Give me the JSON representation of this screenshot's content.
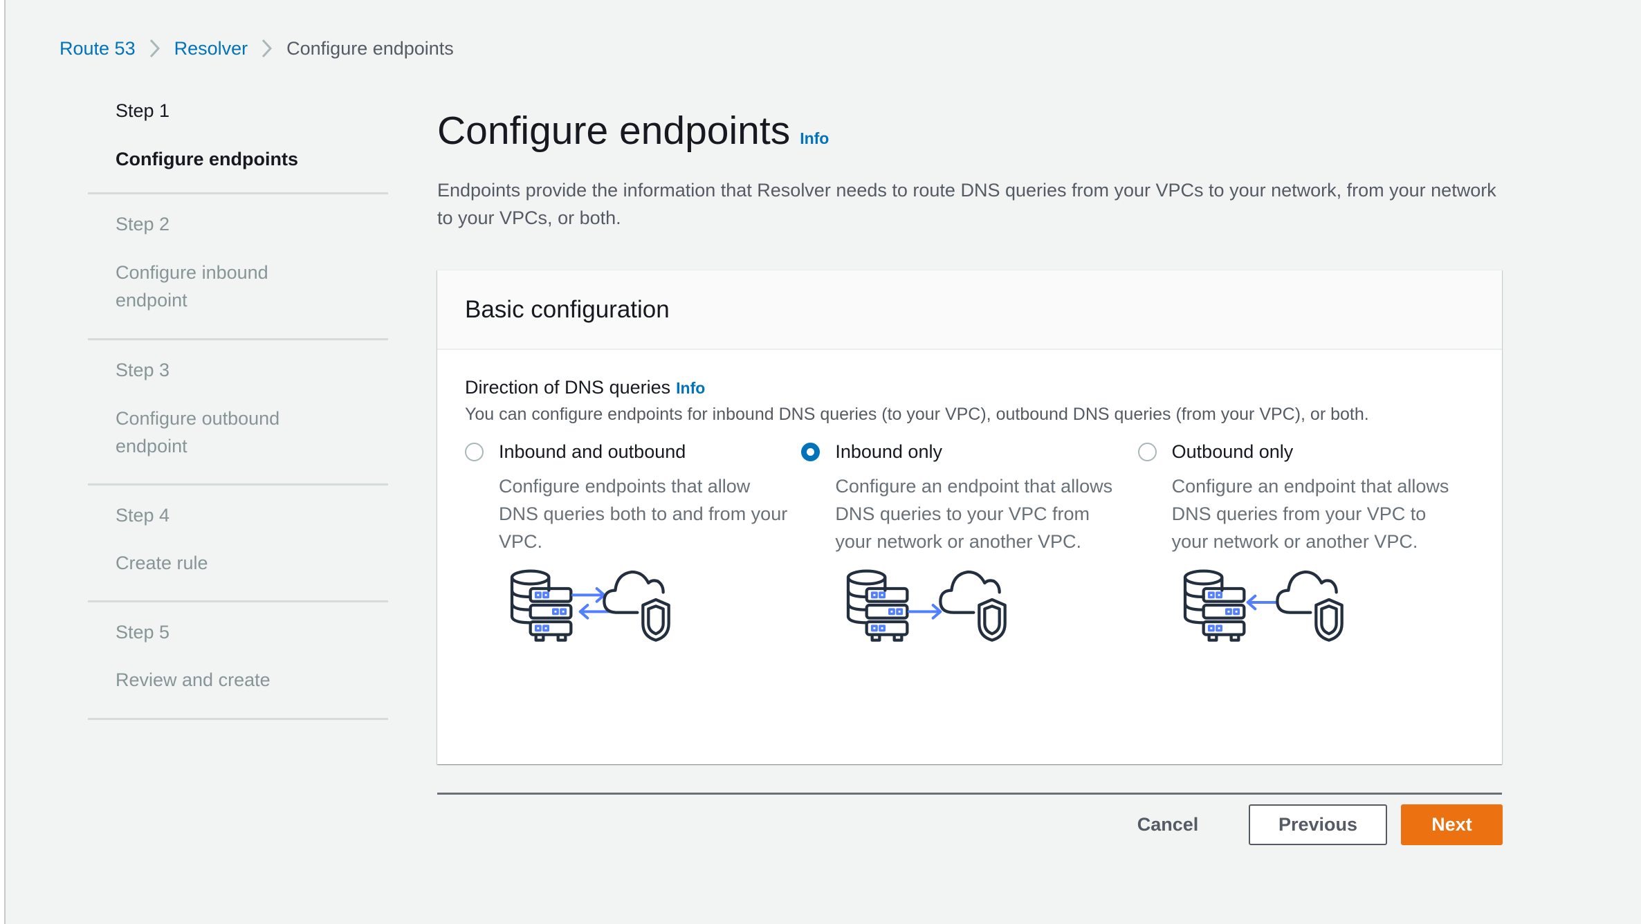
{
  "breadcrumb": {
    "items": [
      {
        "label": "Route 53",
        "link": true
      },
      {
        "label": "Resolver",
        "link": true
      },
      {
        "label": "Configure endpoints",
        "link": false
      }
    ]
  },
  "sidebar": {
    "steps": [
      {
        "number": "Step 1",
        "title": "Configure endpoints",
        "active": true
      },
      {
        "number": "Step 2",
        "title": "Configure inbound endpoint",
        "active": false
      },
      {
        "number": "Step 3",
        "title": "Configure outbound endpoint",
        "active": false
      },
      {
        "number": "Step 4",
        "title": "Create rule",
        "active": false
      },
      {
        "number": "Step 5",
        "title": "Review and create",
        "active": false
      }
    ]
  },
  "main": {
    "title": "Configure endpoints",
    "info_label": "Info",
    "description": "Endpoints provide the information that Resolver needs to route DNS queries from your VPCs to your network, from your network to your VPCs, or both.",
    "card": {
      "title": "Basic configuration",
      "field": {
        "label": "Direction of DNS queries",
        "info_label": "Info",
        "description": "You can configure endpoints for inbound DNS queries (to your VPC), outbound DNS queries (from your VPC), or both."
      },
      "options": [
        {
          "label": "Inbound and outbound",
          "description": "Configure endpoints that allow DNS queries both to and from your VPC.",
          "selected": false,
          "illustration": "bidirectional-dns-illustration"
        },
        {
          "label": "Inbound only",
          "description": "Configure an endpoint that allows DNS queries to your VPC from your network or another VPC.",
          "selected": true,
          "illustration": "inbound-dns-illustration"
        },
        {
          "label": "Outbound only",
          "description": "Configure an endpoint that allows DNS queries from your VPC to your network or another VPC.",
          "selected": false,
          "illustration": "outbound-dns-illustration"
        }
      ],
      "selected_option": "Inbound only"
    }
  },
  "actions": {
    "cancel_label": "Cancel",
    "previous_label": "Previous",
    "next_label": "Next"
  },
  "colors": {
    "link": "#0073bb",
    "primary_button": "#ec7211",
    "illustration_accent": "#527fff",
    "illustration_stroke": "#232f3e"
  }
}
